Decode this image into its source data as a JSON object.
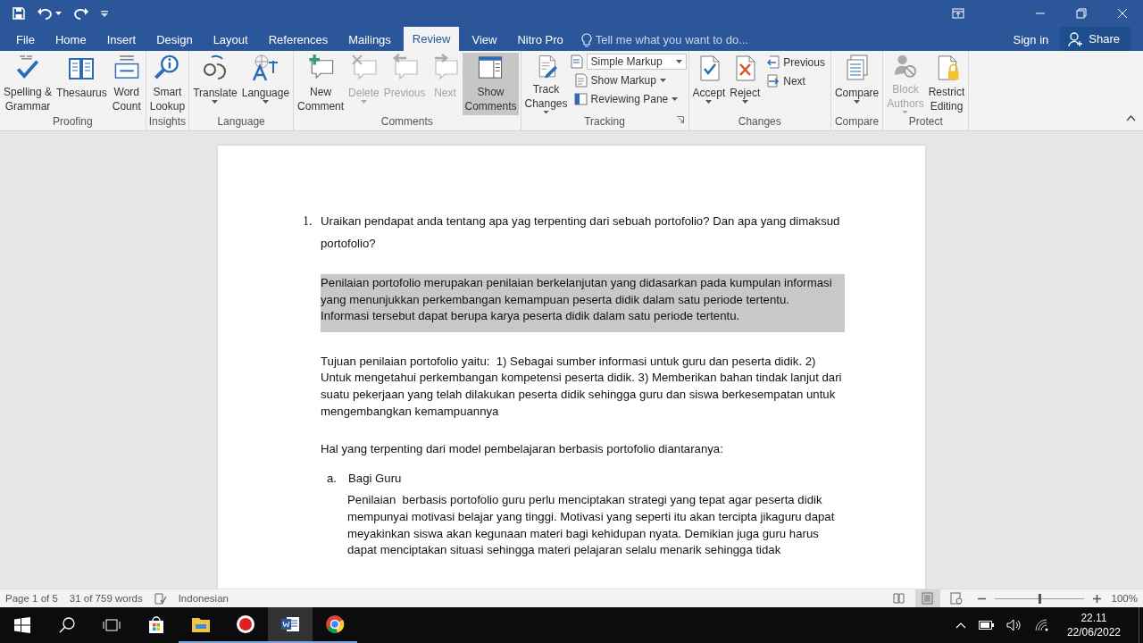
{
  "tabs": [
    {
      "label": "File",
      "selected": false
    },
    {
      "label": "Home",
      "selected": false
    },
    {
      "label": "Insert",
      "selected": false
    },
    {
      "label": "Design",
      "selected": false
    },
    {
      "label": "Layout",
      "selected": false
    },
    {
      "label": "References",
      "selected": false
    },
    {
      "label": "Mailings",
      "selected": false
    },
    {
      "label": "Review",
      "selected": true
    },
    {
      "label": "View",
      "selected": false
    },
    {
      "label": "Nitro Pro",
      "selected": false
    }
  ],
  "tell_me": {
    "placeholder": "Tell me what you want to do..."
  },
  "account": {
    "sign_in": "Sign in",
    "share": "Share"
  },
  "ribbon": {
    "groups": [
      {
        "label": "Proofing",
        "launcher": false,
        "items": [
          {
            "kind": "large",
            "lines": [
              "Spelling &",
              "Grammar"
            ],
            "menu": false,
            "disabled": false,
            "pressed": false
          },
          {
            "kind": "large",
            "lines": [
              "Thesaurus"
            ],
            "menu": false,
            "disabled": false,
            "pressed": false
          },
          {
            "kind": "large",
            "lines": [
              "Word",
              "Count"
            ],
            "menu": false,
            "disabled": false,
            "pressed": false
          }
        ]
      },
      {
        "label": "Insights",
        "launcher": false,
        "items": [
          {
            "kind": "large",
            "lines": [
              "Smart",
              "Lookup"
            ],
            "menu": false,
            "disabled": false,
            "pressed": false
          }
        ]
      },
      {
        "label": "Language",
        "launcher": false,
        "items": [
          {
            "kind": "large",
            "lines": [
              "Translate"
            ],
            "menu": true,
            "disabled": false,
            "pressed": false
          },
          {
            "kind": "large",
            "lines": [
              "Language"
            ],
            "menu": true,
            "disabled": false,
            "pressed": false
          }
        ]
      },
      {
        "label": "Comments",
        "launcher": false,
        "items": [
          {
            "kind": "large",
            "lines": [
              "New",
              "Comment"
            ],
            "menu": false,
            "disabled": false,
            "pressed": false
          },
          {
            "kind": "large",
            "lines": [
              "Delete"
            ],
            "menu": true,
            "disabled": true,
            "pressed": false
          },
          {
            "kind": "large",
            "lines": [
              "Previous"
            ],
            "menu": false,
            "disabled": true,
            "pressed": false
          },
          {
            "kind": "large",
            "lines": [
              "Next"
            ],
            "menu": false,
            "disabled": true,
            "pressed": false
          },
          {
            "kind": "large",
            "lines": [
              "Show",
              "Comments"
            ],
            "menu": false,
            "disabled": false,
            "pressed": true
          }
        ]
      },
      {
        "label": "Tracking",
        "launcher": true,
        "items": [
          {
            "kind": "large",
            "lines": [
              "Track",
              "Changes"
            ],
            "menu": true,
            "disabled": false,
            "pressed": false
          },
          {
            "kind": "stack",
            "items": [
              {
                "kind": "select",
                "label": "Simple Markup",
                "menu": true,
                "disabled": false
              },
              {
                "kind": "small",
                "label": "Show Markup",
                "menu": true,
                "disabled": false
              },
              {
                "kind": "small",
                "label": "Reviewing Pane",
                "menu": true,
                "disabled": false
              }
            ]
          }
        ]
      },
      {
        "label": "Changes",
        "launcher": false,
        "items": [
          {
            "kind": "large",
            "lines": [
              "Accept"
            ],
            "menu": true,
            "disabled": false,
            "pressed": false
          },
          {
            "kind": "large",
            "lines": [
              "Reject"
            ],
            "menu": true,
            "disabled": false,
            "pressed": false
          },
          {
            "kind": "stack",
            "items": [
              {
                "kind": "small",
                "label": "Previous",
                "menu": false,
                "disabled": false
              },
              {
                "kind": "small",
                "label": "Next",
                "menu": false,
                "disabled": false
              }
            ]
          }
        ]
      },
      {
        "label": "Compare",
        "launcher": false,
        "items": [
          {
            "kind": "large",
            "lines": [
              "Compare"
            ],
            "menu": true,
            "disabled": false,
            "pressed": false
          }
        ]
      },
      {
        "label": "Protect",
        "launcher": false,
        "items": [
          {
            "kind": "large",
            "lines": [
              "Block",
              "Authors"
            ],
            "menu": true,
            "disabled": true,
            "pressed": false
          },
          {
            "kind": "large",
            "lines": [
              "Restrict",
              "Editing"
            ],
            "menu": false,
            "disabled": false,
            "pressed": false
          }
        ]
      }
    ]
  },
  "document": {
    "blocks": [
      {
        "kind": "numbered",
        "marker": "1.",
        "text": "Uraikan pendapat anda tentang apa yag terpenting dari sebuah portofolio? Dan apa yang dimaksud portofolio?",
        "highlighted": false
      },
      {
        "kind": "paragraph",
        "text": "Penilaian portofolio merupakan penilaian berkelanjutan yang didasarkan pada kumpulan informasi yang menunjukkan perkembangan kemampuan peserta didik dalam satu periode tertentu. Informasi tersebut dapat berupa karya peserta didik dalam satu periode tertentu.",
        "highlighted": true
      },
      {
        "kind": "paragraph",
        "text": "Tujuan penilaian portofolio yaitu:  1) Sebagai sumber informasi untuk guru dan peserta didik. 2) Untuk mengetahui perkembangan kompetensi peserta didik. 3) Memberikan bahan tindak lanjut dari suatu pekerjaan yang telah dilakukan peserta didik sehingga guru dan siswa berkesempatan untuk mengembangkan kemampuannya",
        "highlighted": false
      },
      {
        "kind": "paragraph",
        "text": "Hal yang terpenting dari model pembelajaran berbasis portofolio diantaranya:",
        "highlighted": false
      },
      {
        "kind": "lettered",
        "marker": "a.",
        "text": "Bagi Guru",
        "highlighted": false
      },
      {
        "kind": "indented",
        "text": "Penilaian  berbasis portofolio guru perlu menciptakan strategi yang tepat agar peserta didik mempunyai motivasi belajar yang tinggi. Motivasi yang seperti itu akan tercipta jikaguru dapat meyakinkan siswa akan kegunaan materi bagi kehidupan nyata. Demikian juga guru harus dapat menciptakan situasi sehingga materi pelajaran selalu menarik sehingga tidak",
        "highlighted": false
      }
    ]
  },
  "status_bar": {
    "page": "Page 1 of 5",
    "words": "31 of 759 words",
    "language": "Indonesian",
    "views": [
      {
        "selected": false
      },
      {
        "selected": true
      },
      {
        "selected": false
      }
    ],
    "zoom": {
      "level": 0.5,
      "label": "100%"
    }
  },
  "taskbar": {
    "apps": [
      {
        "running": false,
        "selected": false
      },
      {
        "running": true,
        "selected": false
      },
      {
        "running": true,
        "selected": false
      },
      {
        "running": true,
        "selected": true
      },
      {
        "running": true,
        "selected": false
      }
    ],
    "time": "22.11",
    "date": "22/06/2022"
  }
}
